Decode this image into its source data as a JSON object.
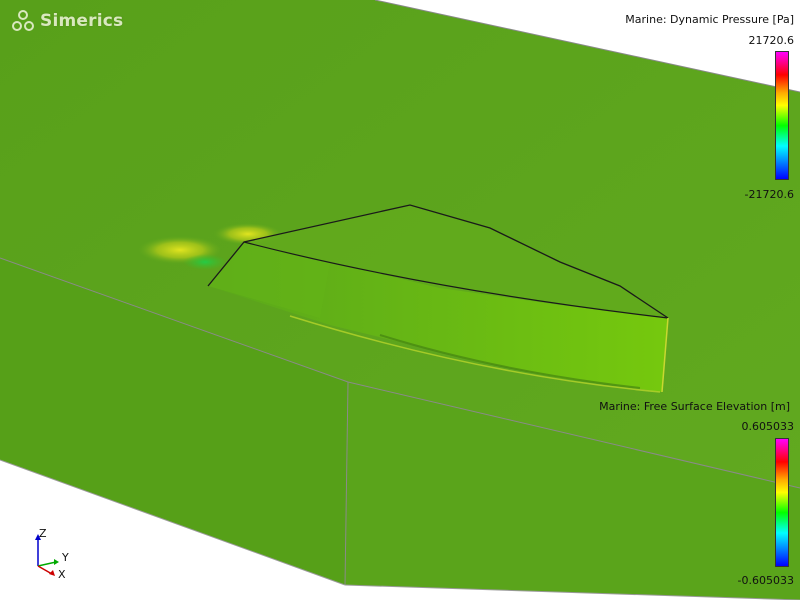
{
  "app": {
    "logo_text": "Simerics"
  },
  "legends": [
    {
      "title": "Marine: Dynamic Pressure [Pa]",
      "max": "21720.6",
      "min": "-21720.6"
    },
    {
      "title": "Marine: Free Surface Elevation [m]",
      "max": "0.605033",
      "min": "-0.605033"
    }
  ],
  "axes": {
    "z": "Z",
    "y": "Y",
    "x": "X"
  },
  "colors": {
    "water": "#5ea61e",
    "hull": "#6fc40f",
    "edge": "#1a1a1a",
    "bbox": "#8a8a8a",
    "background": "#ffffff"
  }
}
